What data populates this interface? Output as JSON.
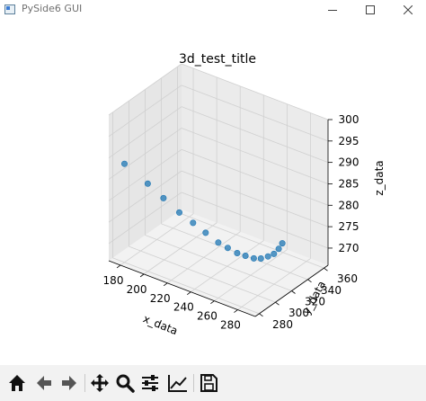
{
  "window": {
    "title": "PySide6 GUI",
    "icon": "app-icon"
  },
  "chart_data": {
    "type": "scatter",
    "projection": "3d",
    "title": "3d_test_title",
    "xlabel": "x_data",
    "ylabel": "y_data",
    "zlabel": "z_data",
    "x_ticks": [
      "180",
      "200",
      "220",
      "240",
      "260",
      "280"
    ],
    "y_ticks": [
      "280",
      "300",
      "320",
      "340",
      "360"
    ],
    "z_ticks": [
      "270",
      "275",
      "280",
      "285",
      "290",
      "295",
      "300"
    ],
    "xlim": [
      170,
      295
    ],
    "ylim": [
      275,
      365
    ],
    "zlim": [
      266,
      300
    ],
    "grid": true,
    "color": "#1f77b4",
    "points": [
      {
        "x": 180,
        "y": 280,
        "z": 289
      },
      {
        "x": 195,
        "y": 287,
        "z": 285
      },
      {
        "x": 205,
        "y": 292,
        "z": 282
      },
      {
        "x": 215,
        "y": 297,
        "z": 279
      },
      {
        "x": 224,
        "y": 301,
        "z": 277
      },
      {
        "x": 232,
        "y": 305,
        "z": 275
      },
      {
        "x": 240,
        "y": 309,
        "z": 273
      },
      {
        "x": 246,
        "y": 312,
        "z": 272
      },
      {
        "x": 252,
        "y": 315,
        "z": 271
      },
      {
        "x": 257,
        "y": 318,
        "z": 270.5
      },
      {
        "x": 262,
        "y": 321,
        "z": 270
      },
      {
        "x": 266,
        "y": 324,
        "z": 270
      },
      {
        "x": 270,
        "y": 327,
        "z": 270.5
      },
      {
        "x": 273,
        "y": 330,
        "z": 271
      },
      {
        "x": 275,
        "y": 333,
        "z": 272
      },
      {
        "x": 276,
        "y": 336,
        "z": 273
      }
    ]
  },
  "toolbar": {
    "tools": [
      {
        "name": "home-icon"
      },
      {
        "name": "back-arrow-icon"
      },
      {
        "name": "forward-arrow-icon"
      },
      {
        "name": "pan-icon"
      },
      {
        "name": "zoom-icon"
      },
      {
        "name": "configure-subplots-icon"
      },
      {
        "name": "edit-axis-icon"
      },
      {
        "name": "save-icon"
      }
    ]
  }
}
